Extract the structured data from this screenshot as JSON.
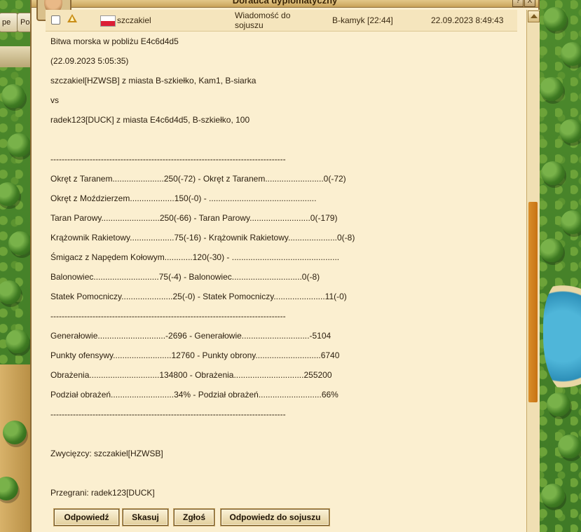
{
  "window": {
    "title": "Doradca dyplomatyczny"
  },
  "toolbar": {
    "btn1": "pe",
    "btn2": "Po"
  },
  "message_row": {
    "sender": "szczakiel",
    "subject": "Wiadomość do sojuszu",
    "from_city": "B-kamyk [22:44]",
    "date": "22.09.2023 8:49:43"
  },
  "report_lines": [
    "Bitwa morska w pobliżu E4c6d4d5",
    "(22.09.2023 5:05:35)",
    "szczakiel[HZWSB] z miasta B-szkiełko, Kam1, B-siarka",
    "vs",
    "radek123[DUCK] z miasta E4c6d4d5, B-szkiełko, 100",
    "",
    "------------------------------------------------------------------------------------",
    "Okręt z Taranem......................250(-72) - Okręt z Taranem.........................0(-72)",
    "Okręt z Moździerzem...................150(-0) - ..............................................",
    "Taran Parowy.........................250(-66) - Taran Parowy..........................0(-179)",
    "Krążownik Rakietowy...................75(-16) - Krążownik Rakietowy.....................0(-8)",
    "Śmigacz z Napędem Kołowym............120(-30) - ..............................................",
    "Balonowiec............................75(-4) - Balonowiec..............................0(-8)",
    "Statek Pomocniczy......................25(-0) - Statek Pomocniczy......................11(-0)",
    "------------------------------------------------------------------------------------",
    "Generałowie.............................-2696 - Generałowie.............................-5104",
    "Punkty ofensywy.........................12760 - Punkty obrony............................6740",
    "Obrażenia..............................134800 - Obrażenia..............................255200",
    "Podział obrażeń...........................34% - Podział obrażeń...........................66%",
    "------------------------------------------------------------------------------------",
    "",
    "Zwycięzcy: szczakiel[HZWSB]",
    "",
    "Przegrani: radek123[DUCK]"
  ],
  "buttons": {
    "reply": "Odpowiedź",
    "delete": "Skasuj",
    "report": "Zgłoś",
    "reply_alliance": "Odpowiedz do sojuszu"
  },
  "icons": {
    "window_help": "?",
    "window_close": "X",
    "warning": "warning-icon",
    "flag": "poland-flag-icon"
  }
}
